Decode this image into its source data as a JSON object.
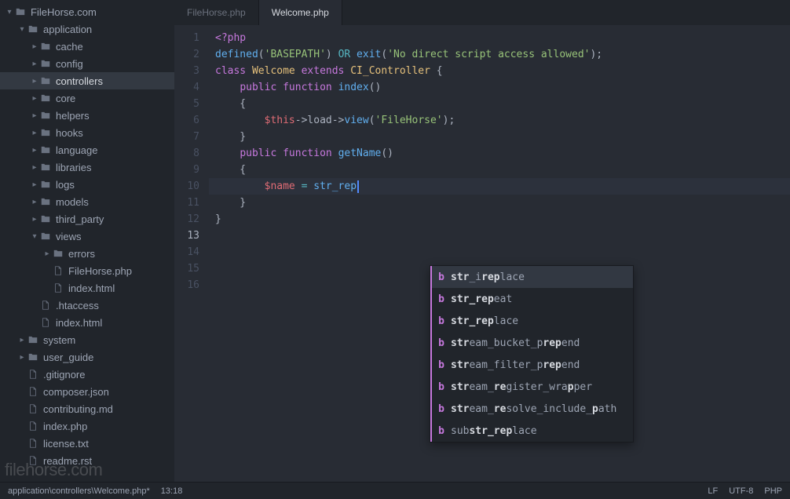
{
  "project_root": "FileHorse.com",
  "sidebar": {
    "tree": [
      {
        "depth": 0,
        "icon": "folder",
        "label": "FileHorse.com",
        "exp": "down"
      },
      {
        "depth": 1,
        "icon": "folder",
        "label": "application",
        "exp": "down"
      },
      {
        "depth": 2,
        "icon": "folder",
        "label": "cache",
        "exp": "right"
      },
      {
        "depth": 2,
        "icon": "folder",
        "label": "config",
        "exp": "right"
      },
      {
        "depth": 2,
        "icon": "folder",
        "label": "controllers",
        "exp": "right",
        "selected": true
      },
      {
        "depth": 2,
        "icon": "folder",
        "label": "core",
        "exp": "right"
      },
      {
        "depth": 2,
        "icon": "folder",
        "label": "helpers",
        "exp": "right"
      },
      {
        "depth": 2,
        "icon": "folder",
        "label": "hooks",
        "exp": "right"
      },
      {
        "depth": 2,
        "icon": "folder",
        "label": "language",
        "exp": "right"
      },
      {
        "depth": 2,
        "icon": "folder",
        "label": "libraries",
        "exp": "right"
      },
      {
        "depth": 2,
        "icon": "folder",
        "label": "logs",
        "exp": "right"
      },
      {
        "depth": 2,
        "icon": "folder",
        "label": "models",
        "exp": "right"
      },
      {
        "depth": 2,
        "icon": "folder",
        "label": "third_party",
        "exp": "right"
      },
      {
        "depth": 2,
        "icon": "folder",
        "label": "views",
        "exp": "down"
      },
      {
        "depth": 3,
        "icon": "folder",
        "label": "errors",
        "exp": "right"
      },
      {
        "depth": 3,
        "icon": "file",
        "label": "FileHorse.php"
      },
      {
        "depth": 3,
        "icon": "file",
        "label": "index.html"
      },
      {
        "depth": 2,
        "icon": "file",
        "label": ".htaccess"
      },
      {
        "depth": 2,
        "icon": "file",
        "label": "index.html"
      },
      {
        "depth": 1,
        "icon": "folder",
        "label": "system",
        "exp": "right"
      },
      {
        "depth": 1,
        "icon": "folder",
        "label": "user_guide",
        "exp": "right"
      },
      {
        "depth": 1,
        "icon": "file",
        "label": ".gitignore"
      },
      {
        "depth": 1,
        "icon": "file",
        "label": "composer.json"
      },
      {
        "depth": 1,
        "icon": "file",
        "label": "contributing.md"
      },
      {
        "depth": 1,
        "icon": "file",
        "label": "index.php"
      },
      {
        "depth": 1,
        "icon": "file",
        "label": "license.txt"
      },
      {
        "depth": 1,
        "icon": "file",
        "label": "readme.rst"
      }
    ]
  },
  "tabs": [
    {
      "label": "FileHorse.php",
      "active": false
    },
    {
      "label": "Welcome.php",
      "active": true
    }
  ],
  "code": {
    "lines": [
      [
        {
          "t": "<?php",
          "c": "t-kw"
        }
      ],
      [
        {
          "t": "defined",
          "c": "t-fn"
        },
        {
          "t": "(",
          "c": "t-pu"
        },
        {
          "t": "'BASEPATH'",
          "c": "t-str"
        },
        {
          "t": ") ",
          "c": "t-pu"
        },
        {
          "t": "OR",
          "c": "t-op"
        },
        {
          "t": " ",
          "c": "t-pu"
        },
        {
          "t": "exit",
          "c": "t-fn"
        },
        {
          "t": "(",
          "c": "t-pu"
        },
        {
          "t": "'No direct script access allowed'",
          "c": "t-str"
        },
        {
          "t": ");",
          "c": "t-pu"
        }
      ],
      [
        {
          "t": "",
          "c": "t-pu"
        }
      ],
      [
        {
          "t": "class ",
          "c": "t-kw"
        },
        {
          "t": "Welcome ",
          "c": "t-cls"
        },
        {
          "t": "extends ",
          "c": "t-kw"
        },
        {
          "t": "CI_Controller ",
          "c": "t-cls"
        },
        {
          "t": "{",
          "c": "t-pu"
        }
      ],
      [
        {
          "t": "",
          "c": "t-pu"
        }
      ],
      [
        {
          "t": "    ",
          "c": "t-pu"
        },
        {
          "t": "public ",
          "c": "t-kw"
        },
        {
          "t": "function ",
          "c": "t-kw"
        },
        {
          "t": "index",
          "c": "t-fn"
        },
        {
          "t": "()",
          "c": "t-pu"
        }
      ],
      [
        {
          "t": "    {",
          "c": "t-pu"
        }
      ],
      [
        {
          "t": "        ",
          "c": "t-pu"
        },
        {
          "t": "$this",
          "c": "t-var"
        },
        {
          "t": "->",
          "c": "t-pu"
        },
        {
          "t": "load",
          "c": "t-default"
        },
        {
          "t": "->",
          "c": "t-pu"
        },
        {
          "t": "view",
          "c": "t-fn"
        },
        {
          "t": "(",
          "c": "t-pu"
        },
        {
          "t": "'FileHorse'",
          "c": "t-str"
        },
        {
          "t": ");",
          "c": "t-pu"
        }
      ],
      [
        {
          "t": "    }",
          "c": "t-pu"
        }
      ],
      [
        {
          "t": "",
          "c": "t-pu"
        }
      ],
      [
        {
          "t": "    ",
          "c": "t-pu"
        },
        {
          "t": "public ",
          "c": "t-kw"
        },
        {
          "t": "function ",
          "c": "t-kw"
        },
        {
          "t": "getName",
          "c": "t-fn"
        },
        {
          "t": "()",
          "c": "t-pu"
        }
      ],
      [
        {
          "t": "    {",
          "c": "t-pu"
        }
      ],
      [
        {
          "t": "        ",
          "c": "t-pu"
        },
        {
          "t": "$name",
          "c": "t-var"
        },
        {
          "t": " ",
          "c": "t-pu"
        },
        {
          "t": "=",
          "c": "t-op"
        },
        {
          "t": " ",
          "c": "t-pu"
        },
        {
          "t": "str_rep",
          "c": "t-fn",
          "cursor": true
        }
      ],
      [
        {
          "t": "    }",
          "c": "t-pu"
        }
      ],
      [
        {
          "t": "}",
          "c": "t-pu"
        }
      ],
      [
        {
          "t": "",
          "c": "t-pu"
        }
      ]
    ],
    "highlight_line": 13
  },
  "autocomplete": {
    "badge": "b",
    "items": [
      {
        "html": "<b>str</b>_i<b>rep</b>lace",
        "selected": true
      },
      {
        "html": "<b>str_rep</b>eat"
      },
      {
        "html": "<b>str_rep</b>lace"
      },
      {
        "html": "<b>str</b>eam_bucket_p<b>rep</b>end"
      },
      {
        "html": "<b>str</b>eam_filter_p<b>rep</b>end"
      },
      {
        "html": "<b>str</b>eam_<b>re</b>gister_wra<b>p</b>per"
      },
      {
        "html": "<b>str</b>eam_<b>re</b>solve_include_<b>p</b>ath"
      },
      {
        "html": "sub<b>str_rep</b>lace"
      }
    ]
  },
  "statusbar": {
    "path": "application\\controllers\\Welcome.php*",
    "cursor": "13:18",
    "line_ending": "LF",
    "encoding": "UTF-8",
    "language": "PHP"
  },
  "watermark": "filehorse.com"
}
